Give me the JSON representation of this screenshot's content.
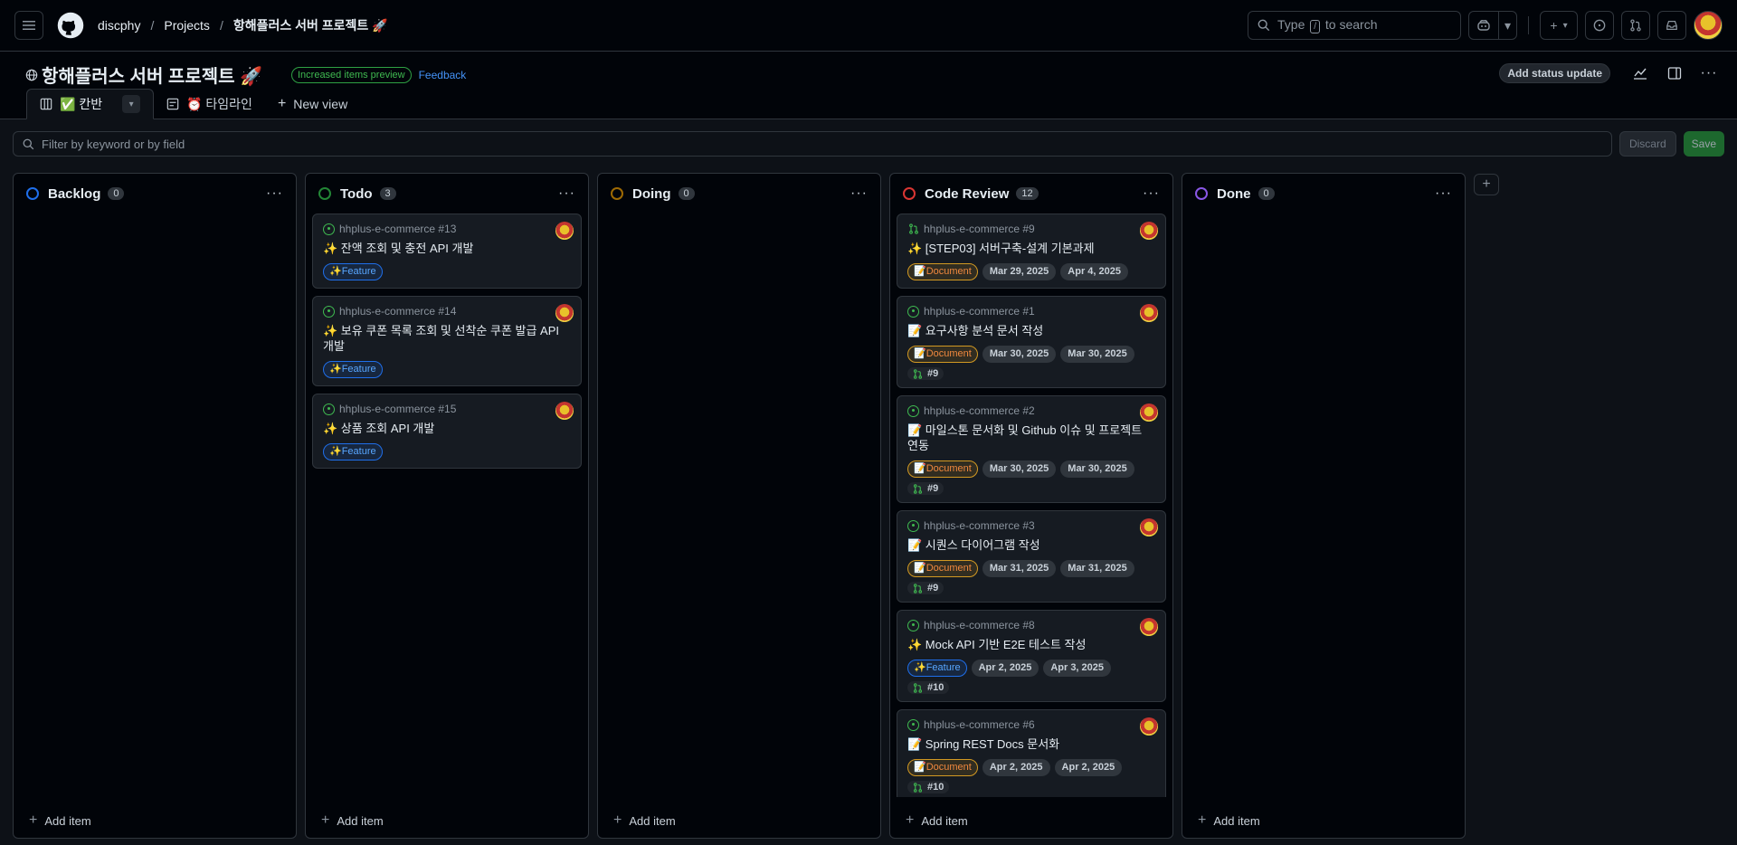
{
  "header": {
    "breadcrumbs": [
      "discphy",
      "Projects",
      "항해플러스 서버 프로젝트 🚀"
    ],
    "search_prefix": "Type",
    "search_key": "/",
    "search_suffix": "to search"
  },
  "project": {
    "title": "항해플러스 서버 프로젝트 🚀",
    "preview_badge": "Increased items preview",
    "feedback": "Feedback",
    "status_button": "Add status update"
  },
  "tabs": [
    {
      "label": "✅ 칸반",
      "active": true
    },
    {
      "label": "⏰ 타임라인",
      "active": false
    },
    {
      "label": "New view",
      "active": false
    }
  ],
  "filter": {
    "placeholder": "Filter by keyword or by field",
    "discard": "Discard",
    "save": "Save"
  },
  "add_item_label": "Add item",
  "columns": [
    {
      "name": "Backlog",
      "count": "0",
      "color": "#1f6feb",
      "cards": []
    },
    {
      "name": "Todo",
      "count": "3",
      "color": "#238636",
      "cards": [
        {
          "type": "issue",
          "repo": "hhplus-e-commerce #13",
          "title": "✨ 잔액 조회 및 충전 API 개발",
          "labels": [
            {
              "k": "feature",
              "t": "✨Feature"
            }
          ],
          "pr": ""
        },
        {
          "type": "issue",
          "repo": "hhplus-e-commerce #14",
          "title": "✨ 보유 쿠폰 목록 조회 및 선착순 쿠폰 발급 API 개발",
          "labels": [
            {
              "k": "feature",
              "t": "✨Feature"
            }
          ],
          "pr": ""
        },
        {
          "type": "issue",
          "repo": "hhplus-e-commerce #15",
          "title": "✨ 상품 조회 API 개발",
          "labels": [
            {
              "k": "feature",
              "t": "✨Feature"
            }
          ],
          "pr": ""
        }
      ]
    },
    {
      "name": "Doing",
      "count": "0",
      "color": "#9e6a03",
      "cards": []
    },
    {
      "name": "Code Review",
      "count": "12",
      "color": "#da3633",
      "cards": [
        {
          "type": "pr",
          "repo": "hhplus-e-commerce #9",
          "title": "✨ [STEP03] 서버구축-설계 기본과제",
          "labels": [
            {
              "k": "document",
              "t": "📝Document"
            },
            {
              "k": "date",
              "t": "Mar 29, 2025"
            },
            {
              "k": "date",
              "t": "Apr 4, 2025"
            }
          ],
          "pr": ""
        },
        {
          "type": "issue",
          "repo": "hhplus-e-commerce #1",
          "title": "📝 요구사항 분석 문서 작성",
          "labels": [
            {
              "k": "document",
              "t": "📝Document"
            },
            {
              "k": "date",
              "t": "Mar 30, 2025"
            },
            {
              "k": "date",
              "t": "Mar 30, 2025"
            }
          ],
          "pr": "#9"
        },
        {
          "type": "issue",
          "repo": "hhplus-e-commerce #2",
          "title": "📝 마일스톤 문서화 및 Github 이슈 및 프로젝트 연동",
          "labels": [
            {
              "k": "document",
              "t": "📝Document"
            },
            {
              "k": "date",
              "t": "Mar 30, 2025"
            },
            {
              "k": "date",
              "t": "Mar 30, 2025"
            }
          ],
          "pr": "#9"
        },
        {
          "type": "issue",
          "repo": "hhplus-e-commerce #3",
          "title": "📝 시퀀스 다이어그램 작성",
          "labels": [
            {
              "k": "document",
              "t": "📝Document"
            },
            {
              "k": "date",
              "t": "Mar 31, 2025"
            },
            {
              "k": "date",
              "t": "Mar 31, 2025"
            }
          ],
          "pr": "#9"
        },
        {
          "type": "issue",
          "repo": "hhplus-e-commerce #8",
          "title": "✨ Mock API 기반 E2E 테스트 작성",
          "labels": [
            {
              "k": "feature",
              "t": "✨Feature"
            },
            {
              "k": "date",
              "t": "Apr 2, 2025"
            },
            {
              "k": "date",
              "t": "Apr 3, 2025"
            }
          ],
          "pr": "#10"
        },
        {
          "type": "issue",
          "repo": "hhplus-e-commerce #6",
          "title": "📝 Spring REST Docs 문서화",
          "labels": [
            {
              "k": "document",
              "t": "📝Document"
            },
            {
              "k": "date",
              "t": "Apr 2, 2025"
            },
            {
              "k": "date",
              "t": "Apr 2, 2025"
            }
          ],
          "pr": "#10"
        }
      ]
    },
    {
      "name": "Done",
      "count": "0",
      "color": "#8957e5",
      "cards": []
    }
  ]
}
